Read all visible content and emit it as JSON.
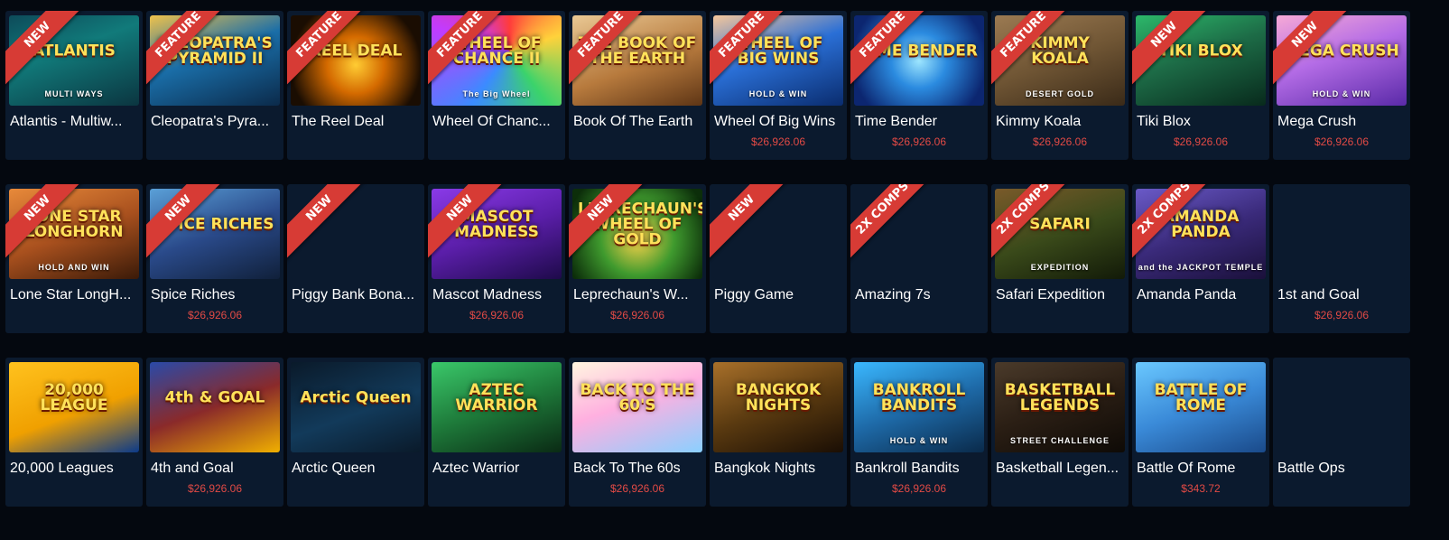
{
  "colors": {
    "page_background": "#04080f",
    "tile_background": "#0b1a2e",
    "ribbon": "#d73b35",
    "jackpot_text": "#e24a45",
    "name_text": "#ffffff"
  },
  "rows": [
    [
      {
        "name": "Atlantis - Multiw...",
        "badge": "NEW",
        "jackpot": "",
        "thumb_text": "ATLANTIS",
        "thumb_sub": "MULTI WAYS",
        "thumb_icon": "atlantis-game-art"
      },
      {
        "name": "Cleopatra's Pyra...",
        "badge": "FEATURE",
        "jackpot": "",
        "thumb_text": "CLEOPATRA'S PYRAMID II",
        "thumb_sub": "",
        "thumb_icon": "cleopatra-game-art"
      },
      {
        "name": "The Reel Deal",
        "badge": "FEATURE",
        "jackpot": "",
        "thumb_text": "REEL DEAL",
        "thumb_sub": "",
        "thumb_icon": "reel-deal-game-art"
      },
      {
        "name": "Wheel Of Chanc...",
        "badge": "FEATURE",
        "jackpot": "",
        "thumb_text": "WHEEL OF CHANCE II",
        "thumb_sub": "The Big Wheel",
        "thumb_icon": "wheel-of-chance-game-art"
      },
      {
        "name": "Book Of The Earth",
        "badge": "FEATURE",
        "jackpot": "",
        "thumb_text": "THE BOOK OF THE EARTH",
        "thumb_sub": "",
        "thumb_icon": "book-of-earth-game-art"
      },
      {
        "name": "Wheel Of Big Wins",
        "badge": "FEATURE",
        "jackpot": "$26,926.06",
        "thumb_text": "WHEEL OF BIG WINS",
        "thumb_sub": "HOLD & WIN",
        "thumb_icon": "wheel-big-wins-game-art"
      },
      {
        "name": "Time Bender",
        "badge": "FEATURE",
        "jackpot": "$26,926.06",
        "thumb_text": "TIME BENDER",
        "thumb_sub": "",
        "thumb_icon": "time-bender-game-art"
      },
      {
        "name": "Kimmy Koala",
        "badge": "FEATURE",
        "jackpot": "$26,926.06",
        "thumb_text": "KIMMY KOALA",
        "thumb_sub": "DESERT GOLD",
        "thumb_icon": "kimmy-koala-game-art"
      },
      {
        "name": "Tiki Blox",
        "badge": "NEW",
        "jackpot": "$26,926.06",
        "thumb_text": "TIKI BLOX",
        "thumb_sub": "",
        "thumb_icon": "tiki-blox-game-art"
      },
      {
        "name": "Mega Crush",
        "badge": "NEW",
        "jackpot": "$26,926.06",
        "thumb_text": "MEGA CRUSH",
        "thumb_sub": "HOLD & WIN",
        "thumb_icon": "mega-crush-game-art"
      }
    ],
    [
      {
        "name": "Lone Star LongH...",
        "badge": "NEW",
        "jackpot": "",
        "thumb_text": "LONE STAR LONGHORN",
        "thumb_sub": "HOLD AND WIN",
        "thumb_icon": "longhorn-game-art"
      },
      {
        "name": "Spice Riches",
        "badge": "NEW",
        "jackpot": "$26,926.06",
        "thumb_text": "SPICE RICHES",
        "thumb_sub": "",
        "thumb_icon": "spice-riches-game-art"
      },
      {
        "name": "Piggy Bank Bona...",
        "badge": "NEW",
        "jackpot": "",
        "thumb_text": "",
        "thumb_sub": "",
        "thumb_icon": "empty-thumbnail"
      },
      {
        "name": "Mascot Madness",
        "badge": "NEW",
        "jackpot": "$26,926.06",
        "thumb_text": "MASCOT MADNESS",
        "thumb_sub": "",
        "thumb_icon": "mascot-madness-game-art"
      },
      {
        "name": "Leprechaun's W...",
        "badge": "NEW",
        "jackpot": "$26,926.06",
        "thumb_text": "LEPRECHAUN'S WHEEL OF GOLD",
        "thumb_sub": "",
        "thumb_icon": "leprechaun-game-art"
      },
      {
        "name": "Piggy Game",
        "badge": "NEW",
        "jackpot": "",
        "thumb_text": "",
        "thumb_sub": "",
        "thumb_icon": "empty-thumbnail"
      },
      {
        "name": "Amazing 7s",
        "badge": "2X COMPS",
        "jackpot": "",
        "thumb_text": "",
        "thumb_sub": "",
        "thumb_icon": "empty-thumbnail"
      },
      {
        "name": "Safari Expedition",
        "badge": "2X COMPS",
        "jackpot": "",
        "thumb_text": "SAFARI",
        "thumb_sub": "EXPEDITION",
        "thumb_icon": "safari-game-art"
      },
      {
        "name": "Amanda Panda",
        "badge": "2X COMPS",
        "jackpot": "",
        "thumb_text": "AMANDA PANDA",
        "thumb_sub": "and the JACKPOT TEMPLE",
        "thumb_icon": "amanda-panda-game-art"
      },
      {
        "name": "1st and Goal",
        "badge": "",
        "jackpot": "$26,926.06",
        "thumb_text": "",
        "thumb_sub": "",
        "thumb_icon": "empty-thumbnail"
      }
    ],
    [
      {
        "name": "20,000 Leagues",
        "badge": "",
        "jackpot": "",
        "thumb_text": "20,000 LEAGUE",
        "thumb_sub": "",
        "thumb_icon": "leagues-game-art"
      },
      {
        "name": "4th and Goal",
        "badge": "",
        "jackpot": "$26,926.06",
        "thumb_text": "4th & GOAL",
        "thumb_sub": "",
        "thumb_icon": "fourth-goal-game-art"
      },
      {
        "name": "Arctic Queen",
        "badge": "",
        "jackpot": "",
        "thumb_text": "Arctic Queen",
        "thumb_sub": "",
        "thumb_icon": "arctic-queen-game-art"
      },
      {
        "name": "Aztec Warrior",
        "badge": "",
        "jackpot": "",
        "thumb_text": "AZTEC WARRIOR",
        "thumb_sub": "",
        "thumb_icon": "aztec-warrior-game-art"
      },
      {
        "name": "Back To The 60s",
        "badge": "",
        "jackpot": "$26,926.06",
        "thumb_text": "BACK TO THE 60'S",
        "thumb_sub": "",
        "thumb_icon": "back-60s-game-art"
      },
      {
        "name": "Bangkok Nights",
        "badge": "",
        "jackpot": "",
        "thumb_text": "BANGKOK NIGHTS",
        "thumb_sub": "",
        "thumb_icon": "bangkok-nights-game-art"
      },
      {
        "name": "Bankroll Bandits",
        "badge": "",
        "jackpot": "$26,926.06",
        "thumb_text": "BANKROLL BANDITS",
        "thumb_sub": "HOLD & WIN",
        "thumb_icon": "bankroll-bandits-game-art"
      },
      {
        "name": "Basketball Legen...",
        "badge": "",
        "jackpot": "",
        "thumb_text": "BASKETBALL LEGENDS",
        "thumb_sub": "STREET CHALLENGE",
        "thumb_icon": "basketball-legends-game-art"
      },
      {
        "name": "Battle Of Rome",
        "badge": "",
        "jackpot": "$343.72",
        "thumb_text": "BATTLE OF ROME",
        "thumb_sub": "",
        "thumb_icon": "battle-rome-game-art"
      },
      {
        "name": "Battle Ops",
        "badge": "",
        "jackpot": "",
        "thumb_text": "",
        "thumb_sub": "",
        "thumb_icon": "empty-thumbnail"
      }
    ]
  ]
}
